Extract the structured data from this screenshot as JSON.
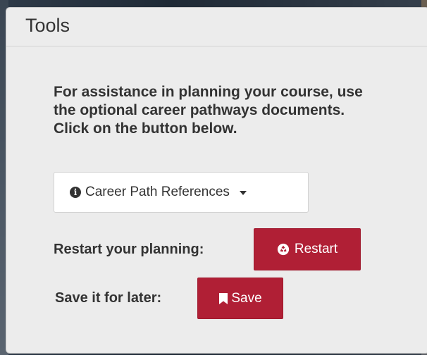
{
  "panel": {
    "title": "Tools"
  },
  "assist": {
    "text": "For assistance in planning your course, use the optional career pathways documents. Click on the button below."
  },
  "dropdown": {
    "label": "Career Path References",
    "icon": "info-circle-icon",
    "caret_icon": "caret-down-icon"
  },
  "restart": {
    "prompt": "Restart your planning:",
    "button_label": "Restart",
    "icon": "recycle-icon"
  },
  "save": {
    "prompt": "Save it for later:",
    "button_label": "Save",
    "icon": "bookmark-icon"
  },
  "colors": {
    "accent": "#b01f35",
    "panel_bg": "#ececec",
    "text": "#333333"
  }
}
